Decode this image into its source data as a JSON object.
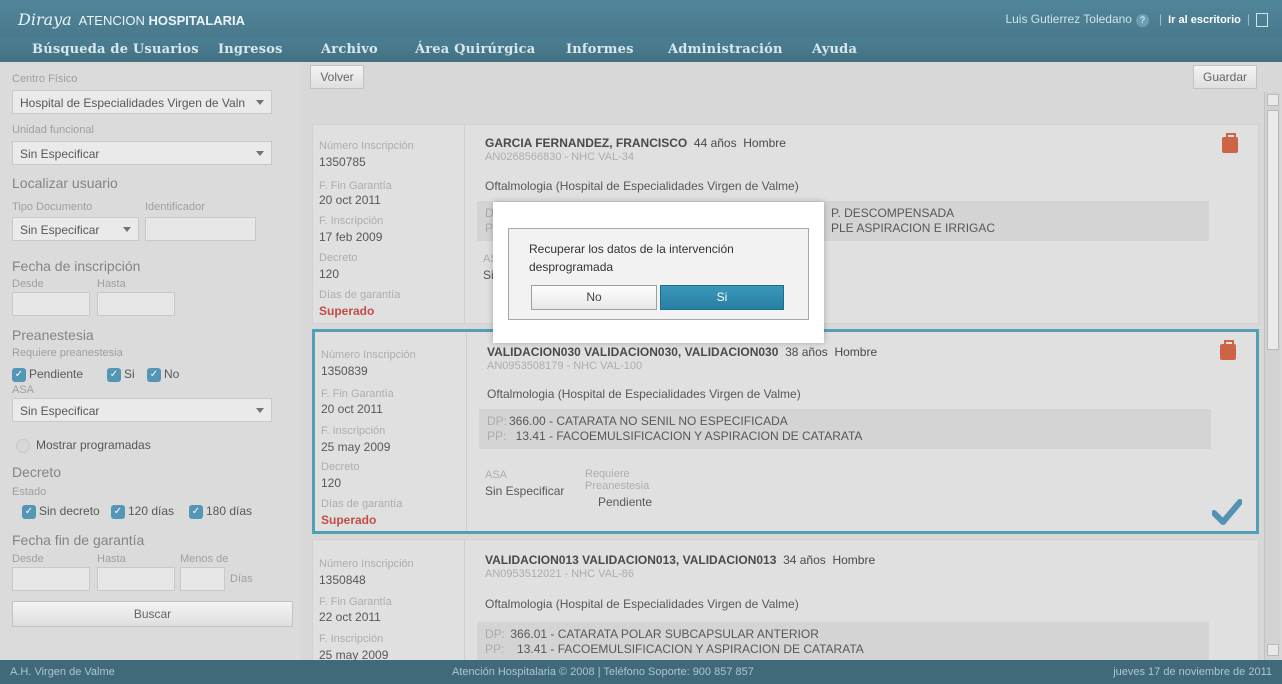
{
  "header": {
    "brand_script": "Diraya",
    "brand_light": "ATENCION",
    "brand_bold": "HOSPITALARIA",
    "user": "Luis Gutierrez Toledano",
    "help": "?",
    "desk": "Ir al escritorio"
  },
  "menu": [
    "Búsqueda de Usuarios",
    "Ingresos",
    "Archivo",
    "Área Quirúrgica",
    "Informes",
    "Administración",
    "Ayuda"
  ],
  "sidebar": {
    "centro_label": "Centro Físico",
    "centro_value": "Hospital de Especialidades Virgen de Valn",
    "unidad_label": "Unidad funcional",
    "unidad_value": "Sin Especificar",
    "localizar": "Localizar usuario",
    "tipo_label": "Tipo Documento",
    "ident_label": "Identificador",
    "tipo_value": "Sin Especificar",
    "fecha_insc": "Fecha de inscripción",
    "desde": "Desde",
    "hasta": "Hasta",
    "preanestesia": "Preanestesia",
    "requiere": "Requiere preanestesia",
    "chk_pendiente": "Pendiente",
    "chk_si": "Si",
    "chk_no": "No",
    "asa_label": "ASA",
    "asa_value": "Sin Especificar",
    "mostrar": "Mostrar programadas",
    "decreto": "Decreto",
    "estado": "Estado",
    "chk_sin": "Sin decreto",
    "chk_120": "120 días",
    "chk_180": "180 días",
    "fecha_fin": "Fecha fin de garantía",
    "menos": "Menos de",
    "dias": "Días",
    "buscar": "Buscar"
  },
  "toolbar": {
    "volver": "Volver",
    "guardar": "Guardar"
  },
  "labels": {
    "num": "Número Inscripción",
    "fin": "F. Fin Garantía",
    "insc": "F. Inscripción",
    "decreto": "Decreto",
    "dias": "Días de garantía",
    "dp": "DP:",
    "pp": "PP:",
    "asa": "ASA",
    "req1": "Requiere",
    "req2": "Preanestesia"
  },
  "cards": [
    {
      "num": "1350785",
      "fin": "20 oct 2011",
      "insc": "17 feb 2009",
      "decreto": "120",
      "dias": "Superado",
      "name": "GARCIA FERNANDEZ, FRANCISCO",
      "edad": "44 años",
      "sexo": "Hombre",
      "nhc": "AN0268566830   - NHC VAL-34",
      "serv": "Oftalmologia (Hospital de Especialidades Virgen de Valme)",
      "dp_frag": "DP:",
      "pp_frag": "PP:",
      "dp_tail": "P. DESCOMPENSADA",
      "pp_tail": "PLE ASPIRACION E IRRIGAC",
      "asa_frag": "AS",
      "asa_val_frag": "Sin"
    },
    {
      "num": "1350839",
      "fin": "20 oct 2011",
      "insc": "25 may 2009",
      "decreto": "120",
      "dias": "Superado",
      "name": "VALIDACION030 VALIDACION030, VALIDACION030",
      "edad": "38 años",
      "sexo": "Hombre",
      "nhc": "AN0953508179   - NHC VAL-100",
      "serv": "Oftalmologia (Hospital de Especialidades Virgen de Valme)",
      "dp": "366.00 - CATARATA NO SENIL NO ESPECIFICADA",
      "pp": "13.41 - FACOEMULSIFICACION Y ASPIRACION DE CATARATA",
      "asa_val": "Sin Especificar",
      "pre_val": "Pendiente"
    },
    {
      "num": "1350848",
      "fin": "22 oct 2011",
      "insc": "25 may 2009",
      "name": "VALIDACION013 VALIDACION013, VALIDACION013",
      "edad": "34 años",
      "sexo": "Hombre",
      "nhc": "AN0953512021   - NHC VAL-86",
      "serv": "Oftalmologia (Hospital de Especialidades Virgen de Valme)",
      "dp": "366.01 - CATARATA POLAR SUBCAPSULAR ANTERIOR",
      "pp": "13.41 - FACOEMULSIFICACION Y ASPIRACION DE CATARATA"
    }
  ],
  "dialog": {
    "message": "Recuperar los datos de la intervención desprogramada",
    "no": "No",
    "si": "Si"
  },
  "footer": {
    "left": "A.H. Virgen de Valme",
    "center": "Atención Hospitalaria © 2008 | Teléfono Soporte: 900 857 857",
    "right": "jueves 17 de noviembre de 2011"
  },
  "colors": {
    "accent": "#2e8aa9",
    "danger": "#b3261e",
    "header": "#1f5a70"
  }
}
